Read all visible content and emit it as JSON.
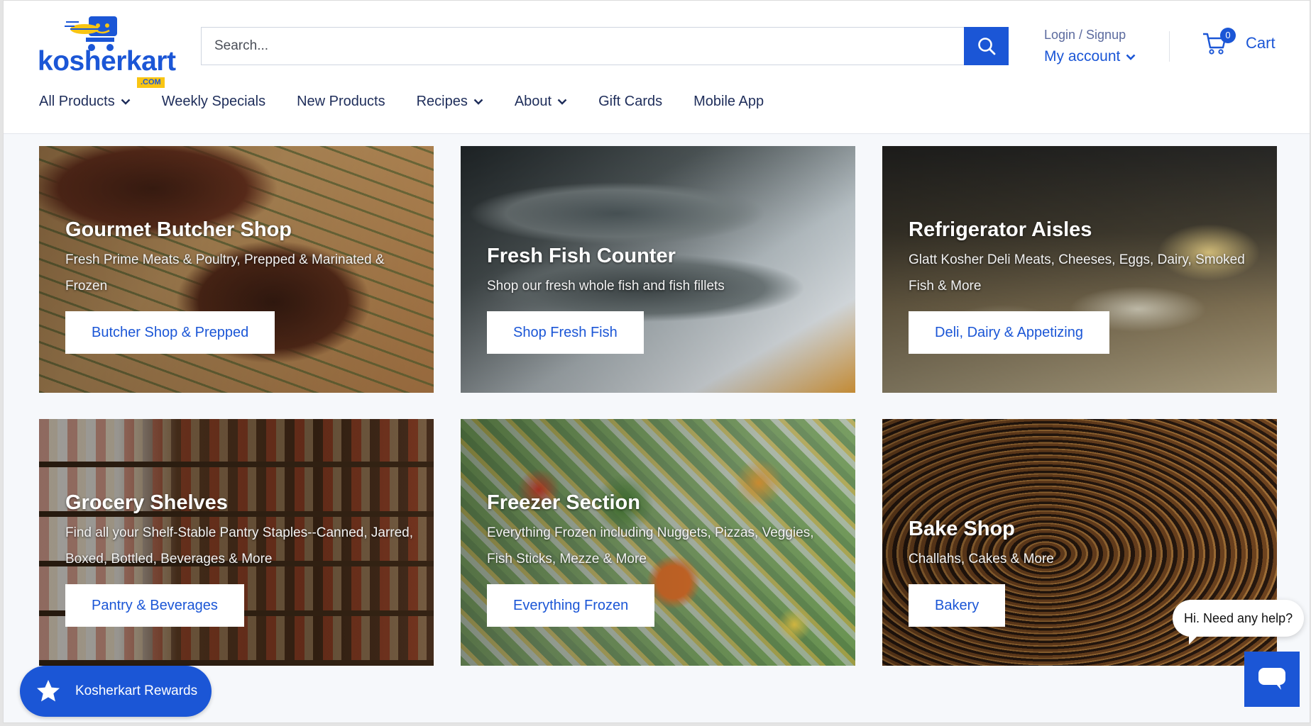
{
  "header": {
    "logo_text": "kosherkart",
    "logo_suffix": ".COM",
    "search_placeholder": "Search...",
    "login_label": "Login / Signup",
    "account_label": "My account",
    "cart_count": "0",
    "cart_label": "Cart"
  },
  "nav": {
    "items": [
      {
        "label": "All Products",
        "has_dropdown": true
      },
      {
        "label": "Weekly Specials",
        "has_dropdown": false
      },
      {
        "label": "New Products",
        "has_dropdown": false
      },
      {
        "label": "Recipes",
        "has_dropdown": true
      },
      {
        "label": "About",
        "has_dropdown": true
      },
      {
        "label": "Gift Cards",
        "has_dropdown": false
      },
      {
        "label": "Mobile App",
        "has_dropdown": false
      }
    ]
  },
  "cards": [
    {
      "title": "Gourmet Butcher Shop",
      "desc": "Fresh Prime Meats & Poultry, Prepped & Marinated & Frozen",
      "button": "Butcher Shop & Prepped"
    },
    {
      "title": "Fresh Fish Counter",
      "desc": "Shop our fresh whole fish and fish fillets",
      "button": "Shop Fresh Fish"
    },
    {
      "title": "Refrigerator Aisles",
      "desc": "Glatt Kosher Deli Meats, Cheeses, Eggs, Dairy, Smoked Fish & More",
      "button": "Deli, Dairy & Appetizing"
    },
    {
      "title": "Grocery Shelves",
      "desc": "Find all your Shelf-Stable Pantry Staples--Canned, Jarred, Boxed, Bottled, Beverages & More",
      "button": "Pantry & Beverages"
    },
    {
      "title": "Freezer Section",
      "desc": "Everything Frozen including Nuggets, Pizzas, Veggies, Fish Sticks, Mezze & More",
      "button": "Everything Frozen"
    },
    {
      "title": "Bake Shop",
      "desc": "Challahs, Cakes & More",
      "button": "Bakery"
    }
  ],
  "widgets": {
    "rewards_label": "Kosherkart Rewards",
    "help_text": "Hi. Need any help?"
  },
  "colors": {
    "brand_blue": "#1b56d6",
    "nav_text": "#1e2d5a",
    "logo_yellow": "#f9c513"
  }
}
